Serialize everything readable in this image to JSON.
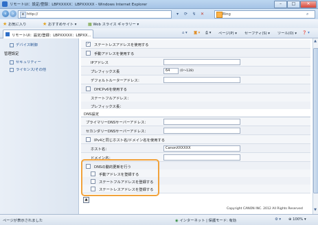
{
  "window": {
    "title": "リモートUI：設定/登録：LBPXXXXX：LBPXXXXX - Windows Internet Explorer",
    "minimize": "–",
    "maximize": "□",
    "close": "✕"
  },
  "address_bar": {
    "back_icon": "back-arrow",
    "forward_icon": "forward-arrow",
    "url": "http://",
    "refresh_icon": "refresh",
    "stop_icon": "stop",
    "search_placeholder": "Bing",
    "search_icon": "magnifier"
  },
  "favorites_bar": {
    "favorites_label": "お気に入り",
    "suggested_sites_label": "おすすめサイト ▾",
    "web_slice_label": "Web スライス ギャラリー ▾"
  },
  "tab": {
    "title": "リモートUI：設定/登録：LBPXXXXX：LBPXX..."
  },
  "command_bar": {
    "page_label": "ページ(P) ▾",
    "safety_label": "セーフティ(S) ▾",
    "tools_label": "ツール(O) ▾",
    "help_label": "❓ ▾"
  },
  "left_pane": {
    "device_control": "デバイス制御",
    "management_settings": "管理設定",
    "security": "セキュリティー",
    "license_other": "ライセンス/その他"
  },
  "form": {
    "stateless_use": "ステートレスアドレスを使用する",
    "manual_use": "手動アドレスを使用する",
    "ip_address_label": "IPアドレス",
    "ip_address_value": "",
    "prefix_length_label": "プレフィックス長",
    "prefix_length_value": "64",
    "prefix_range": "(0〜128)",
    "default_router_label": "デフォルトルーターアドレス：",
    "default_router_value": "",
    "dhcpv6_use": "DHCPv6を使用する",
    "stateful_address_label": "ステートフルアドレス：",
    "stateful_prefix_label": "プレフィックス長：",
    "dns_section": "DNS設定",
    "primary_dns_label": "プライマリーDNSサーバーアドレス：",
    "primary_dns_value": "",
    "secondary_dns_label": "セカンダリーDNSサーバーアドレス：",
    "secondary_dns_value": "",
    "same_host_label": "IPv4と同じホスト名/ドメイン名を使用する",
    "host_name_label": "ホスト名：",
    "host_name_value": "CanonXXXXXX",
    "domain_name_label": "ドメイン名：",
    "domain_name_value": "",
    "dynamic_dns_label": "DNSの動的更新を行う",
    "register_manual_label": "手動アドレスを登録する",
    "register_stateful_label": "ステートフルアドレスを登録する",
    "register_stateless_label": "ステートレスアドレスを登録する"
  },
  "checked": {
    "stateless_use": true,
    "manual_use": false,
    "dhcpv6_use": false,
    "same_host": false,
    "dynamic_dns": false,
    "register_manual": false,
    "register_stateful": false,
    "register_stateless": false
  },
  "footer": {
    "copyright": "Copyright CANON INC. 2012 All Rights Reserved"
  },
  "status_bar": {
    "left_text": "ページが表示されました",
    "zone_text": "インターネット | 保護モード: 有効",
    "zoom_text": "100%"
  },
  "colors": {
    "highlight": "#f1a23b",
    "link": "#1f4f8f"
  }
}
